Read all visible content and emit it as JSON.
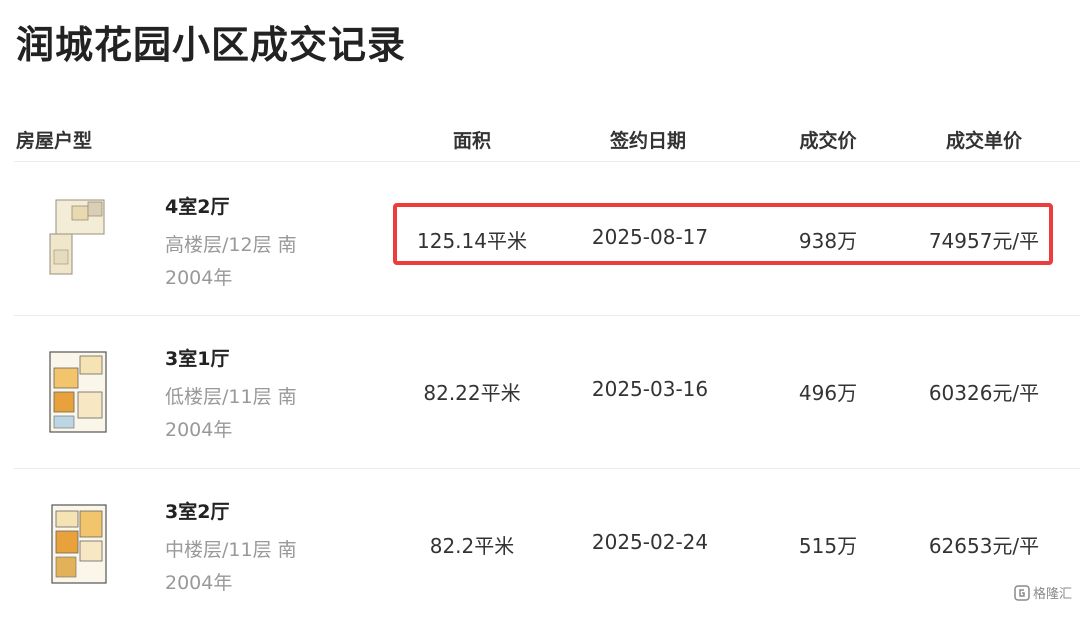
{
  "page": {
    "title": "润城花园小区成交记录"
  },
  "table": {
    "headers": {
      "type": "房屋户型",
      "area": "面积",
      "date": "签约日期",
      "price": "成交价",
      "unit_price": "成交单价"
    },
    "rows": [
      {
        "layout": "4室2厅",
        "floor": "高楼层/12层 南",
        "year": "2004年",
        "area": "125.14平米",
        "date": "2025-08-17",
        "price": "938万",
        "unit_price": "74957元/平"
      },
      {
        "layout": "3室1厅",
        "floor": "低楼层/11层 南",
        "year": "2004年",
        "area": "82.22平米",
        "date": "2025-03-16",
        "price": "496万",
        "unit_price": "60326元/平"
      },
      {
        "layout": "3室2厅",
        "floor": "中楼层/11层 南",
        "year": "2004年",
        "area": "82.2平米",
        "date": "2025-02-24",
        "price": "515万",
        "unit_price": "62653元/平"
      }
    ]
  },
  "colors": {
    "highlight": "#ee3b3b"
  },
  "watermark": {
    "text": "格隆汇",
    "icon": "gelonghui-logo-icon"
  }
}
